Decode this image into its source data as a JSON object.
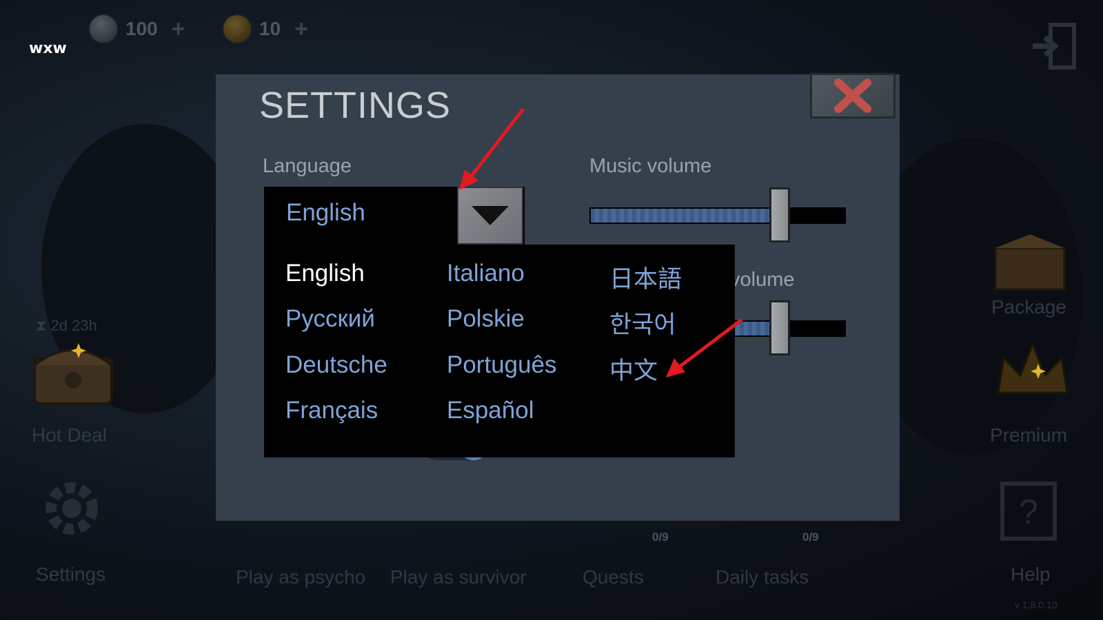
{
  "hud": {
    "brand": "wxw",
    "soul_currency": "100",
    "gold_currency": "10",
    "soul_icon": "pentagram-coin-icon",
    "gold_icon": "skull-coin-icon",
    "add_icon": "plus-icon",
    "exit_icon": "exit-door-icon"
  },
  "side_left": {
    "timer": "⧗ 2d 23h",
    "hot_deal": "Hot Deal",
    "settings": "Settings"
  },
  "side_right": {
    "package": "Package",
    "premium": "Premium",
    "help": "Help",
    "version": "v 1.8.0.10"
  },
  "bottom": {
    "play_psycho": "Play as psycho",
    "play_survivor": "Play as survivor",
    "quests": "Quests",
    "quests_count": "0/9",
    "daily_tasks": "Daily tasks",
    "daily_count": "0/9"
  },
  "settings": {
    "title": "SETTINGS",
    "close_icon": "close-x-icon",
    "language_label": "Language",
    "language_value": "English",
    "music_label": "Music volume",
    "sound_label_partial": "volume",
    "music_level": 0.72,
    "sound_level": 0.72
  },
  "languages": [
    {
      "label": "English",
      "selected": true
    },
    {
      "label": "Русский"
    },
    {
      "label": "Deutsche"
    },
    {
      "label": "Français"
    },
    {
      "label": "Italiano"
    },
    {
      "label": "Polskie"
    },
    {
      "label": "Português"
    },
    {
      "label": "Español"
    },
    {
      "label": "日本語"
    },
    {
      "label": "한국어"
    },
    {
      "label": "中文"
    }
  ],
  "colors": {
    "accent_blue": "#7fa4d8",
    "modal_bg": "#35404c",
    "annotation_red": "#e11a22"
  }
}
